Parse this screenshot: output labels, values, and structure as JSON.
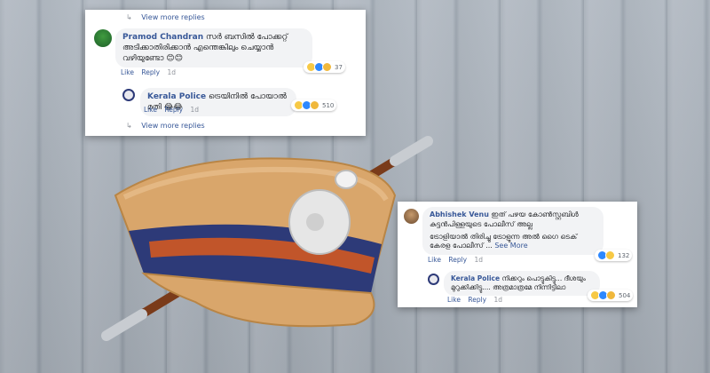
{
  "top_card": {
    "view_more_top": "View more replies",
    "comment1": {
      "author": "Pramod Chandran",
      "text": "സർ ബസിൽ പോക്കറ്റ് അടിക്കാതിരിക്കാൻ എന്തെങ്കിലും ചെയ്യാൻ വഴിയുണ്ടോ 😊😊",
      "actions": [
        "Like",
        "Reply"
      ],
      "time": "1d",
      "reaction_count": "37"
    },
    "reply1": {
      "author": "Kerala Police",
      "text": "ട്രെയിനിൽ പോയാൽ മതി 😂😂",
      "actions": [
        "Like",
        "Reply"
      ],
      "time": "1d",
      "reaction_count": "510"
    },
    "view_more_bottom": "View more replies"
  },
  "bottom_card": {
    "comment2": {
      "author": "Abhishek Venu",
      "text": "ഇത് പഴയ കോൺസ്റ്റബിൾ കുട്ടൻപിള്ളയുടെ പോലീസ് അല്ല",
      "text2": "ട്രോളിയാൽ തിരിച്ചു ട്രോളുന്ന അൽ ഗൈ ടെക് കേരള പോലീസ് ...",
      "see_more": "See More",
      "actions": [
        "Like",
        "Reply"
      ],
      "time": "1d",
      "reaction_count": "132"
    },
    "reply2": {
      "author": "Kerala Police",
      "text": "നിക്കറും പൊട്ടുകിട്ടു... ദീശയും മുറുക്കിക്കിട്ടു.... അത്രമാത്രമേ നിന്നിട്ടിലാ",
      "actions": [
        "Like",
        "Reply"
      ],
      "time": "1d",
      "reaction_count": "504"
    }
  },
  "colors": {
    "link": "#385898",
    "bubble": "#f2f3f5",
    "cap_body": "#d9a66b",
    "cap_band": "#2d3a78",
    "cap_strap": "#c1552a"
  },
  "icons": [
    "comment-arrow-icon",
    "avatar-image",
    "police-emblem-icon",
    "haha-reaction-icon",
    "like-reaction-icon"
  ]
}
